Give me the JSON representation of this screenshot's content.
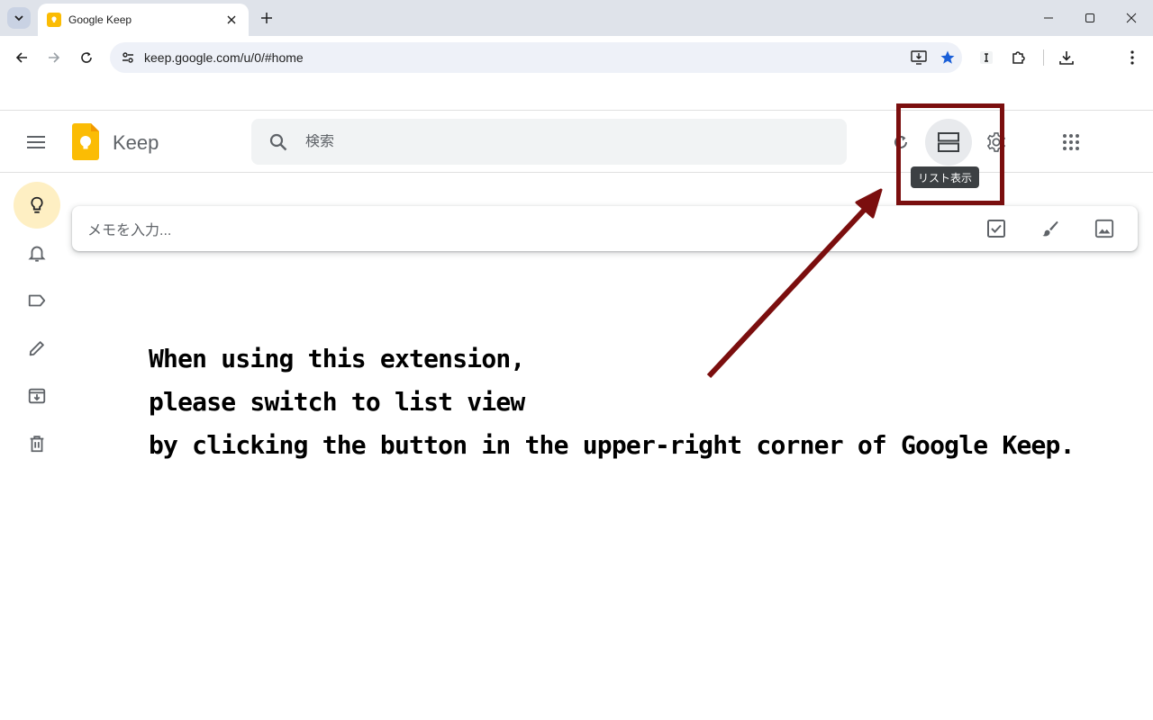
{
  "browser": {
    "tab_title": "Google Keep",
    "url": "keep.google.com/u/0/#home"
  },
  "keep": {
    "app_name": "Keep",
    "search_placeholder": "検索",
    "tooltip": "リスト表示",
    "take_note_placeholder": "メモを入力...",
    "sidebar": [
      "notes",
      "reminders",
      "labels",
      "edit-labels",
      "archive",
      "trash"
    ]
  },
  "annotation": {
    "lines": [
      "When using this extension,",
      "please switch to list view",
      "by clicking the button in the upper-right corner of Google Keep."
    ],
    "color": "#7b0e0e"
  },
  "colors": {
    "keep_yellow": "#fbbc04",
    "active_sidebar": "#feefc3",
    "star_blue": "#1a5fd8"
  }
}
